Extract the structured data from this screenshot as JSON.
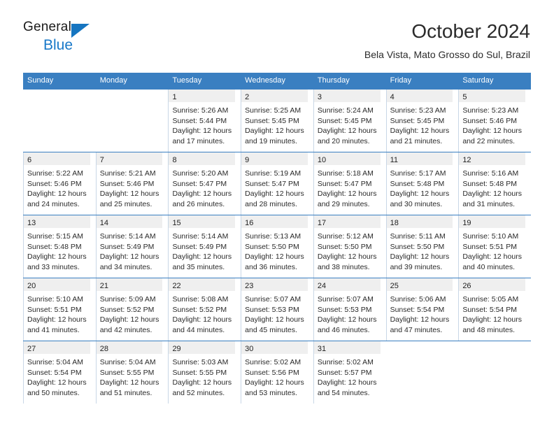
{
  "brand": {
    "name_part1": "General",
    "name_part2": "Blue",
    "logo_icon": "triangle-flag-icon",
    "accent_color": "#1675c0"
  },
  "header": {
    "title": "October 2024",
    "subtitle": "Bela Vista, Mato Grosso do Sul, Brazil"
  },
  "colors": {
    "header_blue": "#3a7fc1",
    "daynum_band": "#efefef",
    "text": "#2a2a2a"
  },
  "calendar": {
    "weekday_headers": [
      "Sunday",
      "Monday",
      "Tuesday",
      "Wednesday",
      "Thursday",
      "Friday",
      "Saturday"
    ],
    "weeks": [
      [
        {
          "day": "",
          "empty": true
        },
        {
          "day": "",
          "empty": true
        },
        {
          "day": "1",
          "sunrise": "Sunrise: 5:26 AM",
          "sunset": "Sunset: 5:44 PM",
          "daylight1": "Daylight: 12 hours",
          "daylight2": "and 17 minutes."
        },
        {
          "day": "2",
          "sunrise": "Sunrise: 5:25 AM",
          "sunset": "Sunset: 5:45 PM",
          "daylight1": "Daylight: 12 hours",
          "daylight2": "and 19 minutes."
        },
        {
          "day": "3",
          "sunrise": "Sunrise: 5:24 AM",
          "sunset": "Sunset: 5:45 PM",
          "daylight1": "Daylight: 12 hours",
          "daylight2": "and 20 minutes."
        },
        {
          "day": "4",
          "sunrise": "Sunrise: 5:23 AM",
          "sunset": "Sunset: 5:45 PM",
          "daylight1": "Daylight: 12 hours",
          "daylight2": "and 21 minutes."
        },
        {
          "day": "5",
          "sunrise": "Sunrise: 5:23 AM",
          "sunset": "Sunset: 5:46 PM",
          "daylight1": "Daylight: 12 hours",
          "daylight2": "and 22 minutes."
        }
      ],
      [
        {
          "day": "6",
          "sunrise": "Sunrise: 5:22 AM",
          "sunset": "Sunset: 5:46 PM",
          "daylight1": "Daylight: 12 hours",
          "daylight2": "and 24 minutes."
        },
        {
          "day": "7",
          "sunrise": "Sunrise: 5:21 AM",
          "sunset": "Sunset: 5:46 PM",
          "daylight1": "Daylight: 12 hours",
          "daylight2": "and 25 minutes."
        },
        {
          "day": "8",
          "sunrise": "Sunrise: 5:20 AM",
          "sunset": "Sunset: 5:47 PM",
          "daylight1": "Daylight: 12 hours",
          "daylight2": "and 26 minutes."
        },
        {
          "day": "9",
          "sunrise": "Sunrise: 5:19 AM",
          "sunset": "Sunset: 5:47 PM",
          "daylight1": "Daylight: 12 hours",
          "daylight2": "and 28 minutes."
        },
        {
          "day": "10",
          "sunrise": "Sunrise: 5:18 AM",
          "sunset": "Sunset: 5:47 PM",
          "daylight1": "Daylight: 12 hours",
          "daylight2": "and 29 minutes."
        },
        {
          "day": "11",
          "sunrise": "Sunrise: 5:17 AM",
          "sunset": "Sunset: 5:48 PM",
          "daylight1": "Daylight: 12 hours",
          "daylight2": "and 30 minutes."
        },
        {
          "day": "12",
          "sunrise": "Sunrise: 5:16 AM",
          "sunset": "Sunset: 5:48 PM",
          "daylight1": "Daylight: 12 hours",
          "daylight2": "and 31 minutes."
        }
      ],
      [
        {
          "day": "13",
          "sunrise": "Sunrise: 5:15 AM",
          "sunset": "Sunset: 5:48 PM",
          "daylight1": "Daylight: 12 hours",
          "daylight2": "and 33 minutes."
        },
        {
          "day": "14",
          "sunrise": "Sunrise: 5:14 AM",
          "sunset": "Sunset: 5:49 PM",
          "daylight1": "Daylight: 12 hours",
          "daylight2": "and 34 minutes."
        },
        {
          "day": "15",
          "sunrise": "Sunrise: 5:14 AM",
          "sunset": "Sunset: 5:49 PM",
          "daylight1": "Daylight: 12 hours",
          "daylight2": "and 35 minutes."
        },
        {
          "day": "16",
          "sunrise": "Sunrise: 5:13 AM",
          "sunset": "Sunset: 5:50 PM",
          "daylight1": "Daylight: 12 hours",
          "daylight2": "and 36 minutes."
        },
        {
          "day": "17",
          "sunrise": "Sunrise: 5:12 AM",
          "sunset": "Sunset: 5:50 PM",
          "daylight1": "Daylight: 12 hours",
          "daylight2": "and 38 minutes."
        },
        {
          "day": "18",
          "sunrise": "Sunrise: 5:11 AM",
          "sunset": "Sunset: 5:50 PM",
          "daylight1": "Daylight: 12 hours",
          "daylight2": "and 39 minutes."
        },
        {
          "day": "19",
          "sunrise": "Sunrise: 5:10 AM",
          "sunset": "Sunset: 5:51 PM",
          "daylight1": "Daylight: 12 hours",
          "daylight2": "and 40 minutes."
        }
      ],
      [
        {
          "day": "20",
          "sunrise": "Sunrise: 5:10 AM",
          "sunset": "Sunset: 5:51 PM",
          "daylight1": "Daylight: 12 hours",
          "daylight2": "and 41 minutes."
        },
        {
          "day": "21",
          "sunrise": "Sunrise: 5:09 AM",
          "sunset": "Sunset: 5:52 PM",
          "daylight1": "Daylight: 12 hours",
          "daylight2": "and 42 minutes."
        },
        {
          "day": "22",
          "sunrise": "Sunrise: 5:08 AM",
          "sunset": "Sunset: 5:52 PM",
          "daylight1": "Daylight: 12 hours",
          "daylight2": "and 44 minutes."
        },
        {
          "day": "23",
          "sunrise": "Sunrise: 5:07 AM",
          "sunset": "Sunset: 5:53 PM",
          "daylight1": "Daylight: 12 hours",
          "daylight2": "and 45 minutes."
        },
        {
          "day": "24",
          "sunrise": "Sunrise: 5:07 AM",
          "sunset": "Sunset: 5:53 PM",
          "daylight1": "Daylight: 12 hours",
          "daylight2": "and 46 minutes."
        },
        {
          "day": "25",
          "sunrise": "Sunrise: 5:06 AM",
          "sunset": "Sunset: 5:54 PM",
          "daylight1": "Daylight: 12 hours",
          "daylight2": "and 47 minutes."
        },
        {
          "day": "26",
          "sunrise": "Sunrise: 5:05 AM",
          "sunset": "Sunset: 5:54 PM",
          "daylight1": "Daylight: 12 hours",
          "daylight2": "and 48 minutes."
        }
      ],
      [
        {
          "day": "27",
          "sunrise": "Sunrise: 5:04 AM",
          "sunset": "Sunset: 5:54 PM",
          "daylight1": "Daylight: 12 hours",
          "daylight2": "and 50 minutes."
        },
        {
          "day": "28",
          "sunrise": "Sunrise: 5:04 AM",
          "sunset": "Sunset: 5:55 PM",
          "daylight1": "Daylight: 12 hours",
          "daylight2": "and 51 minutes."
        },
        {
          "day": "29",
          "sunrise": "Sunrise: 5:03 AM",
          "sunset": "Sunset: 5:55 PM",
          "daylight1": "Daylight: 12 hours",
          "daylight2": "and 52 minutes."
        },
        {
          "day": "30",
          "sunrise": "Sunrise: 5:02 AM",
          "sunset": "Sunset: 5:56 PM",
          "daylight1": "Daylight: 12 hours",
          "daylight2": "and 53 minutes."
        },
        {
          "day": "31",
          "sunrise": "Sunrise: 5:02 AM",
          "sunset": "Sunset: 5:57 PM",
          "daylight1": "Daylight: 12 hours",
          "daylight2": "and 54 minutes."
        },
        {
          "day": "",
          "empty": true
        },
        {
          "day": "",
          "empty": true
        }
      ]
    ]
  }
}
